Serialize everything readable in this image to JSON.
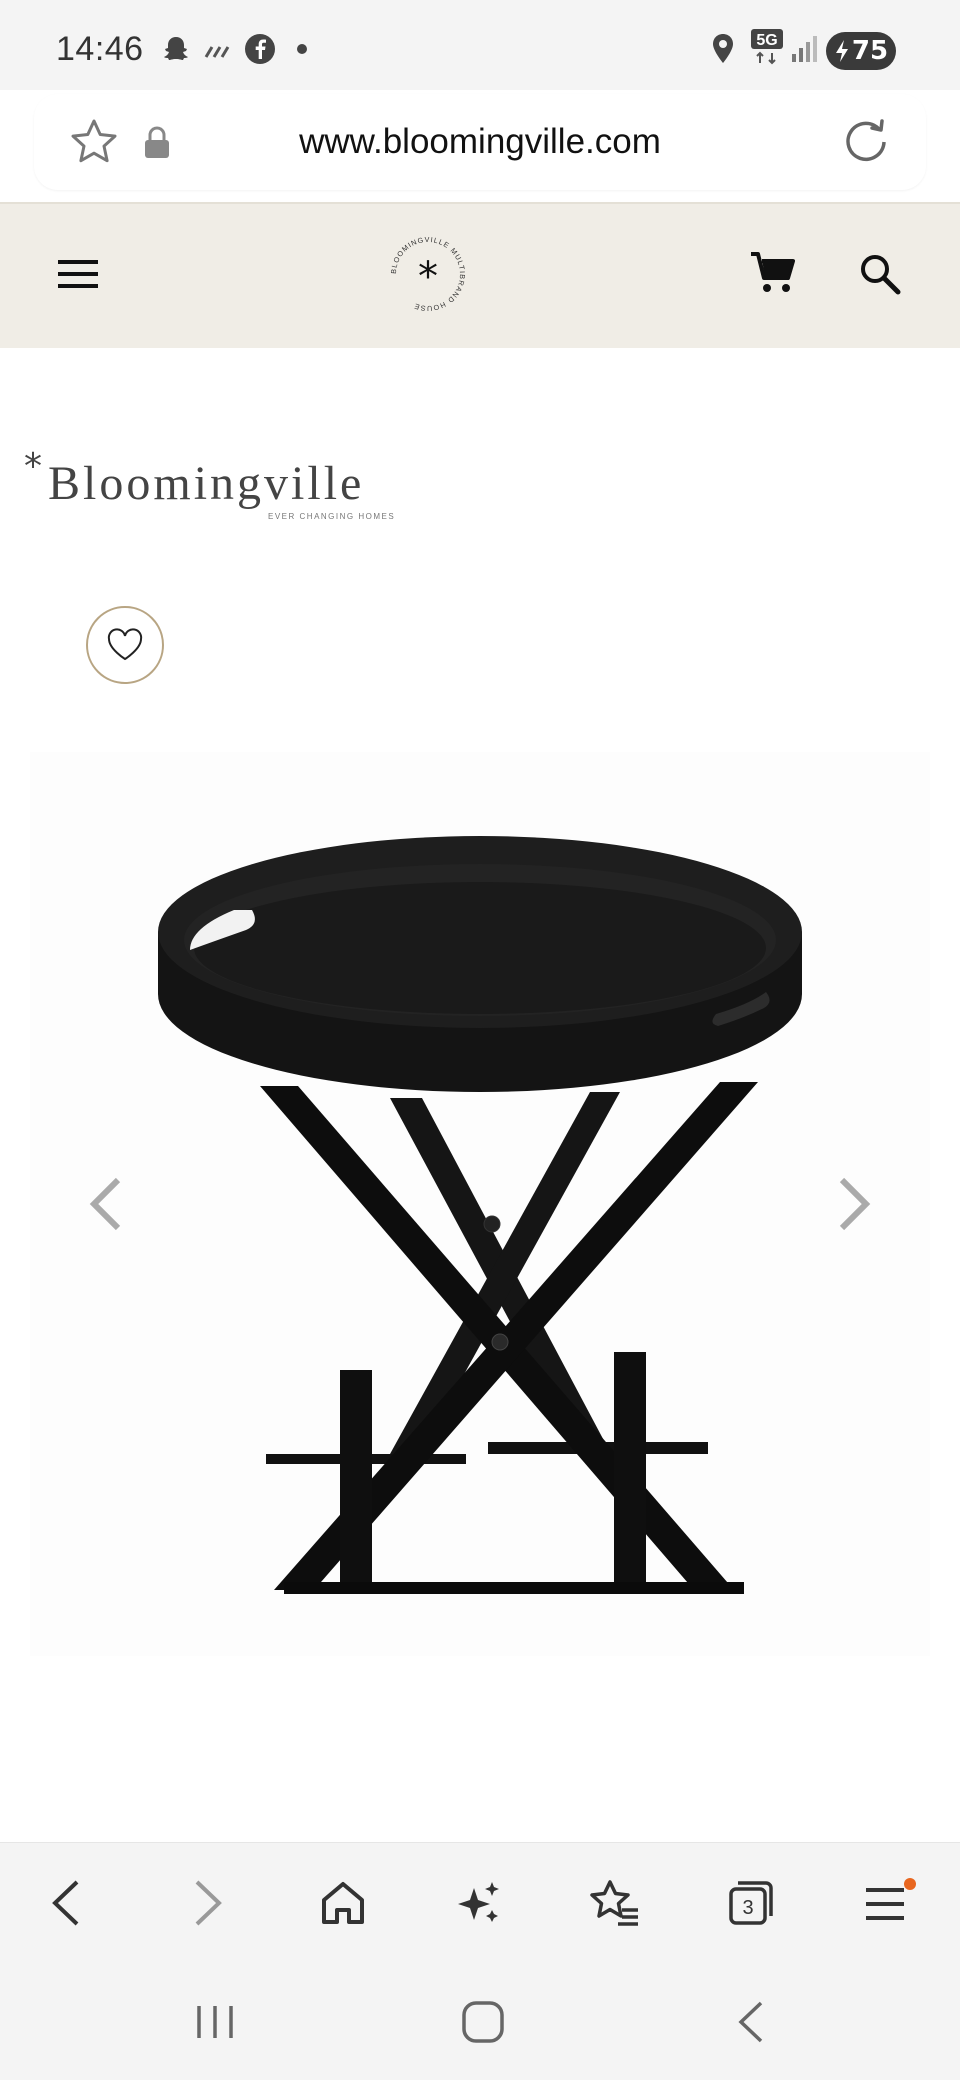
{
  "status_bar": {
    "time": "14:46",
    "battery": "75",
    "network": "5G"
  },
  "browser": {
    "url": "www.bloomingville.com",
    "tabs_count": "3"
  },
  "site": {
    "logo_ring_text": "BLOOMINGVILLE MULTIBRAND HOUSE",
    "brand_name": "Bloomingville",
    "brand_tagline": "EVER CHANGING HOMES",
    "accent_color": "#b8a583",
    "header_bg": "#f0ede6"
  },
  "icons": {
    "status": [
      "snapchat-icon",
      "signal-bars-icon",
      "facebook-icon",
      "dot-icon",
      "location-icon",
      "5g-icon",
      "cell-signal-icon",
      "battery-icon"
    ],
    "url_bar": [
      "star-outline-icon",
      "lock-icon",
      "reload-icon"
    ],
    "site_header": [
      "hamburger-menu-icon",
      "cart-icon",
      "search-icon"
    ],
    "toolbar": [
      "back-icon",
      "forward-icon",
      "home-icon",
      "sparkle-icon",
      "bookmarks-icon",
      "tabs-icon",
      "menu-icon"
    ]
  }
}
